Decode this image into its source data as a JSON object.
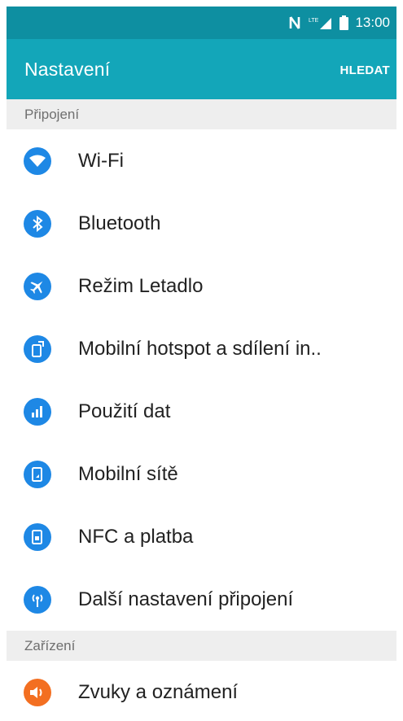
{
  "status_bar": {
    "time": "13:00",
    "icons": [
      "nfc-icon",
      "lte-signal-icon",
      "battery-icon"
    ]
  },
  "app_bar": {
    "title": "Nastavení",
    "action_label": "HLEDAT"
  },
  "sections": [
    {
      "header": "Připojení",
      "items": [
        {
          "label": "Wi-Fi",
          "icon": "wifi-icon"
        },
        {
          "label": "Bluetooth",
          "icon": "bluetooth-icon"
        },
        {
          "label": "Režim Letadlo",
          "icon": "airplane-icon"
        },
        {
          "label": "Mobilní hotspot a sdílení in..",
          "icon": "hotspot-icon"
        },
        {
          "label": "Použití dat",
          "icon": "data-usage-icon"
        },
        {
          "label": "Mobilní sítě",
          "icon": "mobile-networks-icon"
        },
        {
          "label": "NFC a platba",
          "icon": "nfc-payment-icon"
        },
        {
          "label": "Další nastavení připojení",
          "icon": "more-connection-icon"
        }
      ]
    },
    {
      "header": "Zařízení",
      "items": [
        {
          "label": "Zvuky a oznámení",
          "icon": "sound-icon"
        }
      ]
    }
  ],
  "colors": {
    "status_bar": "#0E8FA1",
    "app_bar": "#13A6B9",
    "section_bg": "#EEEEEE",
    "icon_blue": "#1E88E5",
    "icon_orange": "#F36F21"
  }
}
